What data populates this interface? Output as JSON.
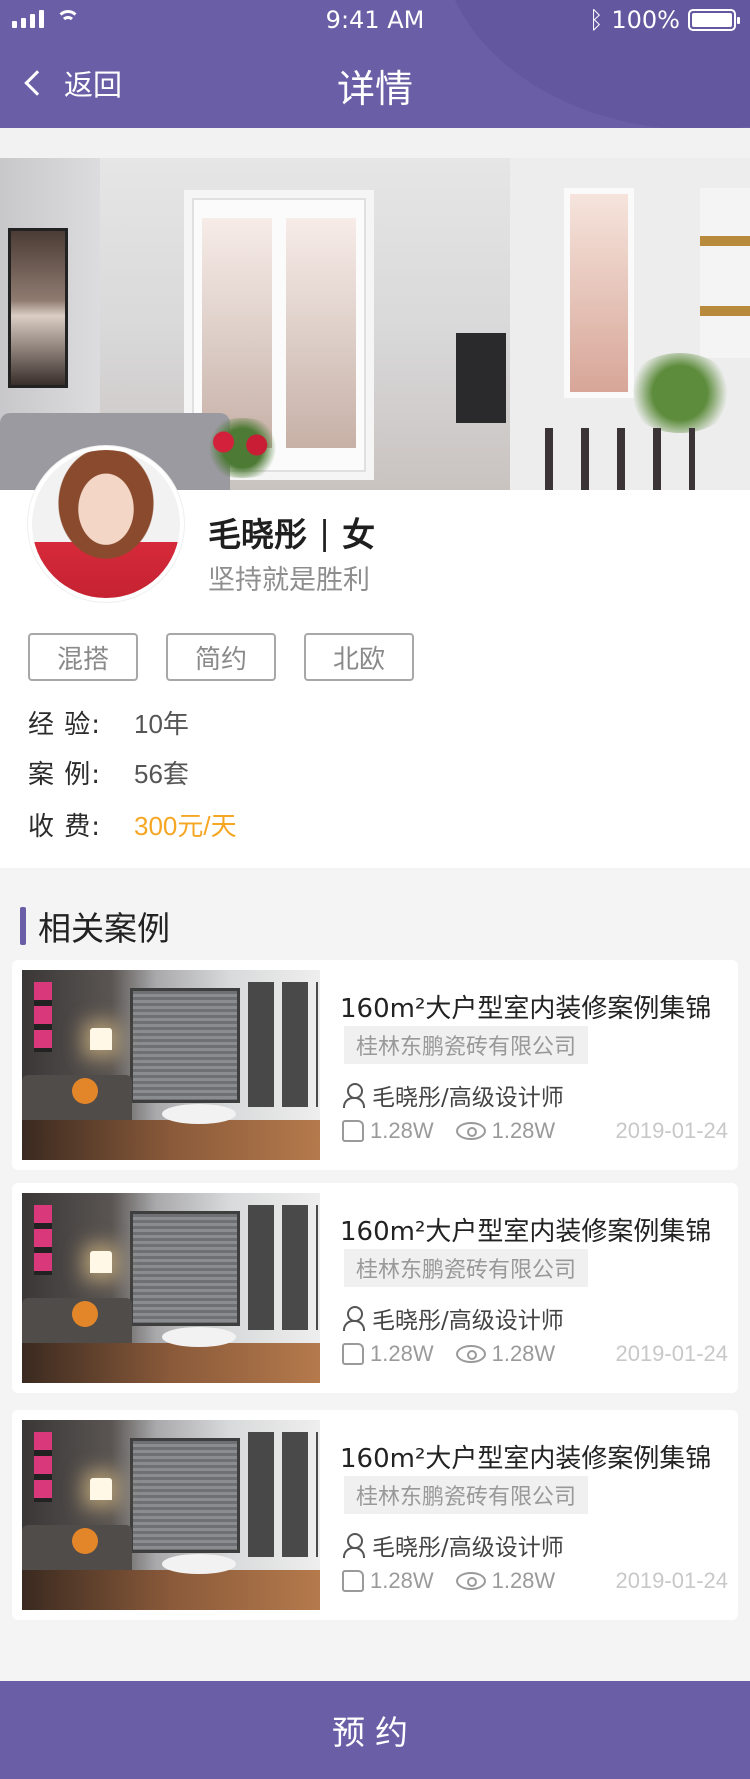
{
  "status_bar": {
    "time": "9:41 AM",
    "battery": "100%"
  },
  "nav": {
    "back_label": "返回",
    "title": "详情"
  },
  "profile": {
    "name": "毛晓彤",
    "separator": "|",
    "gender": "女",
    "motto": "坚持就是胜利",
    "tags": [
      "混搭",
      "简约",
      "北欧"
    ],
    "info": [
      {
        "label": "经  验:",
        "value": "10年"
      },
      {
        "label": "案  例:",
        "value": "56套"
      },
      {
        "label": "收  费:",
        "value": "300元/天"
      }
    ]
  },
  "related": {
    "title": "相关案例",
    "cases": [
      {
        "title": "160m²大户型室内装修案例集锦",
        "company": "桂林东鹏瓷砖有限公司",
        "designer": "毛晓彤/高级设计师",
        "likes": "1.28W",
        "views": "1.28W",
        "date": "2019-01-24"
      },
      {
        "title": "160m²大户型室内装修案例集锦",
        "company": "桂林东鹏瓷砖有限公司",
        "designer": "毛晓彤/高级设计师",
        "likes": "1.28W",
        "views": "1.28W",
        "date": "2019-01-24"
      },
      {
        "title": "160m²大户型室内装修案例集锦",
        "company": "桂林东鹏瓷砖有限公司",
        "designer": "毛晓彤/高级设计师",
        "likes": "1.28W",
        "views": "1.28W",
        "date": "2019-01-24"
      }
    ]
  },
  "booking": {
    "label": "预约"
  },
  "colors": {
    "accent": "#6a5fa6",
    "price": "#f5a623"
  }
}
